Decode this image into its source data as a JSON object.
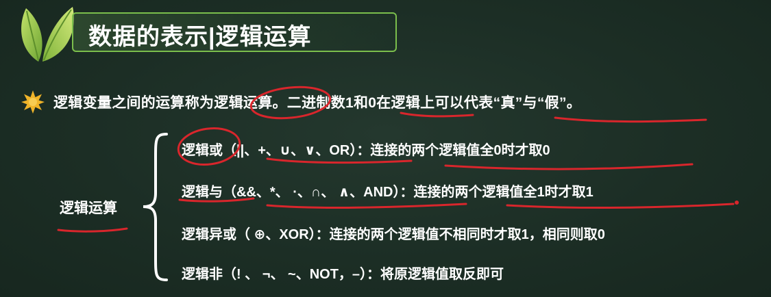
{
  "title": "数据的表示|逻辑运算",
  "intro": "逻辑变量之间的运算称为逻辑运算。二进制数1和0在逻辑上可以代表“真”与“假”。",
  "operations_label": "逻辑运算",
  "operations": [
    {
      "text": "逻辑或（||、+、∪、∨、OR）：连接的两个逻辑值全0时才取0"
    },
    {
      "text": "逻辑与（&&、*、 ·、∩、 ∧、AND）：连接的两个逻辑值全1时才取1"
    },
    {
      "text": "逻辑异或（ ⊕、XOR）：连接的两个逻辑值不相同时才取1，相同则取0"
    },
    {
      "text": "逻辑非（! 、 ¬、 ~、NOT，–）：将原逻辑值取反即可"
    }
  ],
  "icons": {
    "logo": "green-leaf-icon",
    "bullet": "star-icon"
  },
  "colors": {
    "background": "#1c2e25",
    "title_border": "#7bbf4c",
    "leaf": "#9ccc4a",
    "star": "#f0b429",
    "annotation": "#d9262c"
  }
}
